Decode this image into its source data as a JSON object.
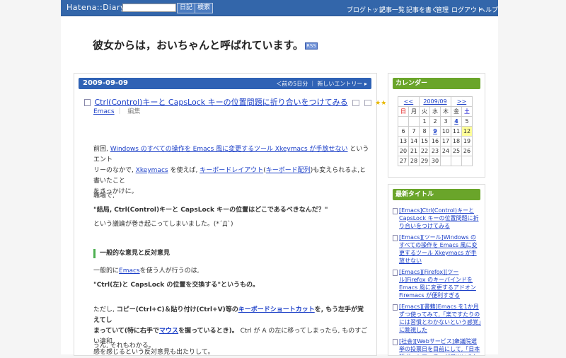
{
  "topbar": {
    "logo": "Hatena::Diary",
    "search_value": "",
    "diary_button": "日記",
    "search_button": "検索",
    "links": [
      "ブログトップ",
      "記事一覧",
      "記事を書く",
      "管理",
      "ログアウト",
      "ヘルプ"
    ]
  },
  "blog": {
    "title": "彼女からは，おいちゃんと呼ばれています。",
    "rss": "RSS"
  },
  "entry": {
    "date": "2009-09-09",
    "nav_prev": "＜前の5日分",
    "nav_sep": "｜",
    "nav_new": "新しいエントリー",
    "nav_arrow": "▸",
    "title": "Ctrl(Control)キーと CapsLock キーの位置問題に折り合いをつけてみる",
    "stars": "★★",
    "category": "Emacs",
    "category_sep": "｜",
    "edit": "編集",
    "p1_a": "前回,",
    "p1_link1": "Windows のすべての操作を Emacs 風に変更するツール Xkeymacs が手放せない",
    "p1_b": "というエント",
    "p1_c": "リーのなかで,",
    "p1_link2": "Xkeymacs",
    "p1_d": "を使えば,",
    "p1_link3": "キーボードレイアウト",
    "p1_e": "(",
    "p1_link4": "キーボード配列",
    "p1_f": ")も変えられるよ,と書いたこと",
    "p1_g": "をきっかけに。",
    "p2": "職場で,",
    "p3": "\"結局, Ctrl(Control)キーと CapsLock キーの位置はどこであるべきなんだ？\"",
    "p4": "という議論が巻き起こってしまいました。(*´Д`)",
    "heading": "一般的な意見と反対意見",
    "p5_a": "一般的に",
    "p5_link": "Emacs",
    "p5_b": "を使う人が行うのは,",
    "p6": "\"Ctrl(左)と CapsLock の位置を交換する\"というもの。",
    "p7_a": "ただし,",
    "p7_b": "コピー(Ctrl+C)＆貼り付け(Ctrl+V)等の",
    "p7_link": "キーボードショートカット",
    "p7_c": "を, もう左手が覚えてし",
    "p7_d": "まっていて(特に右手で",
    "p7_link2": "マウス",
    "p7_e": "を握っているとき)。",
    "p7_f": "Ctrl が A の左に移ってしまったら, ものすごい違和",
    "p7_g": "感を感じるという反対意見も出たりして。",
    "p8": "うん, それもわかる。"
  },
  "calendar": {
    "header": "カレンダー",
    "prev": "<<",
    "month": "2009/09",
    "next": ">>",
    "weekdays": [
      "日",
      "月",
      "火",
      "水",
      "木",
      "金",
      "土"
    ],
    "rows": [
      [
        "",
        "",
        "1",
        "2",
        "3",
        "4",
        "5"
      ],
      [
        "6",
        "7",
        "8",
        "9",
        "10",
        "11",
        "12"
      ],
      [
        "13",
        "14",
        "15",
        "16",
        "17",
        "18",
        "19"
      ],
      [
        "20",
        "21",
        "22",
        "23",
        "24",
        "25",
        "26"
      ],
      [
        "27",
        "28",
        "29",
        "30",
        "",
        "",
        ""
      ]
    ],
    "linked_days": [
      "4",
      "9"
    ],
    "today": "12"
  },
  "recent": {
    "header": "最新タイトル",
    "items": [
      "[Emacs]Ctrl(Control)キーと CapsLock キーの位置問題に折り合いをつけてみる",
      "[Emacs][ツール]Windows のすべての操作を Emacs 風に変更するツール Xkeymacs が手放せない",
      "[Emacs][Firefox][ツール]Firefox のキーバインドを Emacs 風に変更するアドオン Firemacs が便利すぎる",
      "[Emacs][書籍]Emacs を1か月ずつ使ってみて,「楽ですたりのには習慣とわかないという感覚」に眺視した",
      "[社会][Webサービス]衆議院選挙の投票日を目前にして,「日本版ボートマッチ」がアツいらしい"
    ]
  },
  "colors": {
    "topbar": "#3366aa",
    "datebar": "#2f62b5",
    "sidebar_head": "#6aa52a",
    "link": "#1a3ec7"
  }
}
